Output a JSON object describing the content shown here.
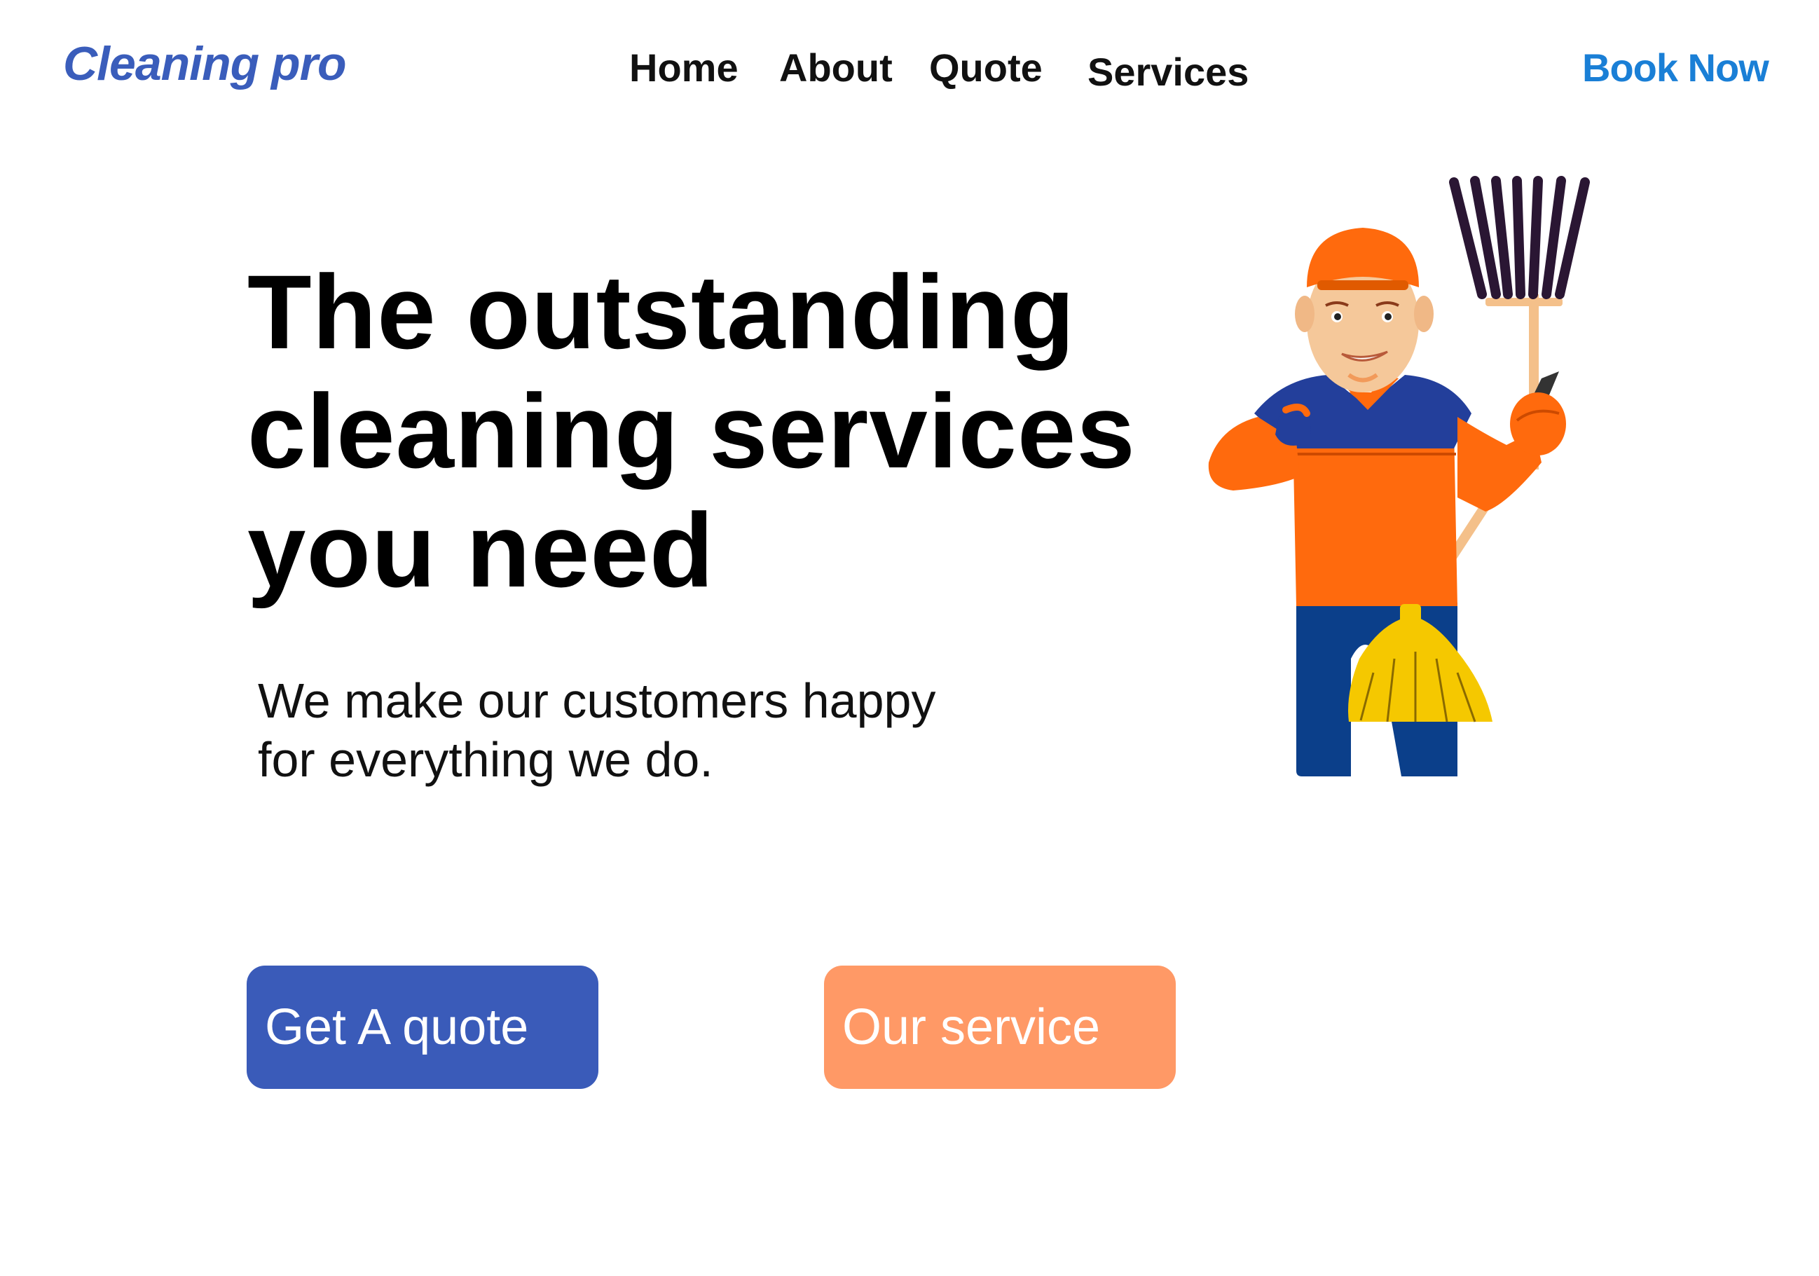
{
  "header": {
    "brand": "Cleaning pro",
    "nav": [
      {
        "label": "Home"
      },
      {
        "label": "About"
      },
      {
        "label": "Quote"
      },
      {
        "label": "Services"
      }
    ],
    "cta_label": "Book Now"
  },
  "hero": {
    "title_lines": [
      "The outstanding",
      "cleaning services",
      "you need"
    ],
    "subtitle_lines": [
      "We make our customers happy",
      "for everything we do."
    ],
    "primary_button": "Get A quote",
    "secondary_button": "Our service"
  },
  "colors": {
    "brand": "#3a5dbb",
    "book_now": "#1a7fd6",
    "primary_button": "#3a5bb9",
    "secondary_button": "#ff9966",
    "illustration_orange": "#ff6a0d",
    "illustration_blue": "#233f9b",
    "illustration_yellow": "#f5c800"
  },
  "illustration": {
    "icon": "cleaner-with-broom-and-rake-illustration"
  }
}
